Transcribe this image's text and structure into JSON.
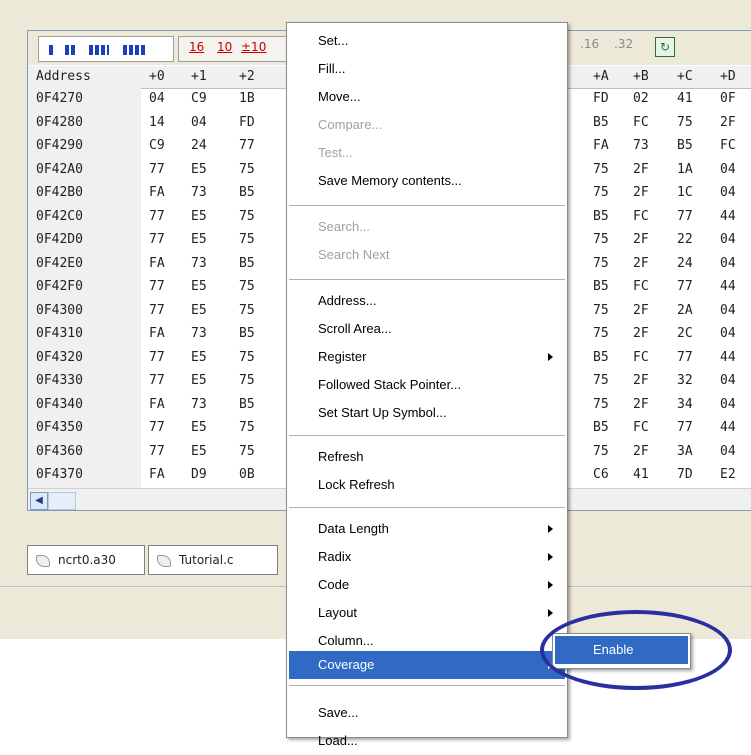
{
  "toolbar": {
    "radix_labels": [
      "16",
      "10",
      "±10"
    ],
    "radix_right_labels": [
      ".16",
      ".32"
    ],
    "refresh_glyph": "↻"
  },
  "table": {
    "headers": [
      "Address",
      "+0",
      "+1",
      "+2",
      "+A",
      "+B",
      "+C",
      "+D"
    ],
    "rows": [
      {
        "addr": "0F4270",
        "left": [
          "04",
          "C9",
          "1B"
        ],
        "right": [
          "FD",
          "02",
          "41",
          "0F"
        ]
      },
      {
        "addr": "0F4280",
        "left": [
          "14",
          "04",
          "FD"
        ],
        "right": [
          "B5",
          "FC",
          "75",
          "2F"
        ]
      },
      {
        "addr": "0F4290",
        "left": [
          "C9",
          "24",
          "77"
        ],
        "right": [
          "FA",
          "73",
          "B5",
          "FC"
        ]
      },
      {
        "addr": "0F42A0",
        "left": [
          "77",
          "E5",
          "75"
        ],
        "right": [
          "75",
          "2F",
          "1A",
          "04"
        ]
      },
      {
        "addr": "0F42B0",
        "left": [
          "FA",
          "73",
          "B5"
        ],
        "right": [
          "75",
          "2F",
          "1C",
          "04"
        ]
      },
      {
        "addr": "0F42C0",
        "left": [
          "77",
          "E5",
          "75"
        ],
        "right": [
          "B5",
          "FC",
          "77",
          "44"
        ]
      },
      {
        "addr": "0F42D0",
        "left": [
          "77",
          "E5",
          "75"
        ],
        "right": [
          "75",
          "2F",
          "22",
          "04"
        ]
      },
      {
        "addr": "0F42E0",
        "left": [
          "FA",
          "73",
          "B5"
        ],
        "right": [
          "75",
          "2F",
          "24",
          "04"
        ]
      },
      {
        "addr": "0F42F0",
        "left": [
          "77",
          "E5",
          "75"
        ],
        "right": [
          "B5",
          "FC",
          "77",
          "44"
        ]
      },
      {
        "addr": "0F4300",
        "left": [
          "77",
          "E5",
          "75"
        ],
        "right": [
          "75",
          "2F",
          "2A",
          "04"
        ]
      },
      {
        "addr": "0F4310",
        "left": [
          "FA",
          "73",
          "B5"
        ],
        "right": [
          "75",
          "2F",
          "2C",
          "04"
        ]
      },
      {
        "addr": "0F4320",
        "left": [
          "77",
          "E5",
          "75"
        ],
        "right": [
          "B5",
          "FC",
          "77",
          "44"
        ]
      },
      {
        "addr": "0F4330",
        "left": [
          "77",
          "E5",
          "75"
        ],
        "right": [
          "75",
          "2F",
          "32",
          "04"
        ]
      },
      {
        "addr": "0F4340",
        "left": [
          "FA",
          "73",
          "B5"
        ],
        "right": [
          "75",
          "2F",
          "34",
          "04"
        ]
      },
      {
        "addr": "0F4350",
        "left": [
          "77",
          "E5",
          "75"
        ],
        "right": [
          "B5",
          "FC",
          "77",
          "44"
        ]
      },
      {
        "addr": "0F4360",
        "left": [
          "77",
          "E5",
          "75"
        ],
        "right": [
          "75",
          "2F",
          "3A",
          "04"
        ]
      },
      {
        "addr": "0F4370",
        "left": [
          "FA",
          "D9",
          "0B"
        ],
        "right": [
          "C6",
          "41",
          "7D",
          "E2"
        ]
      }
    ]
  },
  "tabs": [
    {
      "label": "ncrt0.a30"
    },
    {
      "label": "Tutorial.c"
    }
  ],
  "context_menu": {
    "items": [
      {
        "label": "Set...",
        "disabled": false,
        "submenu": false
      },
      {
        "label": "Fill...",
        "disabled": false,
        "submenu": false
      },
      {
        "label": "Move...",
        "disabled": false,
        "submenu": false
      },
      {
        "label": "Compare...",
        "disabled": true,
        "submenu": false
      },
      {
        "label": "Test...",
        "disabled": true,
        "submenu": false
      },
      {
        "label": "Save Memory contents...",
        "disabled": false,
        "submenu": false
      },
      {
        "label": "Search...",
        "disabled": true,
        "submenu": false
      },
      {
        "label": "Search Next",
        "disabled": true,
        "submenu": false
      },
      {
        "label": "Address...",
        "disabled": false,
        "submenu": false
      },
      {
        "label": "Scroll Area...",
        "disabled": false,
        "submenu": false
      },
      {
        "label": "Register",
        "disabled": false,
        "submenu": true
      },
      {
        "label": "Followed Stack Pointer...",
        "disabled": false,
        "submenu": false
      },
      {
        "label": "Set Start Up Symbol...",
        "disabled": false,
        "submenu": false
      },
      {
        "label": "Refresh",
        "disabled": false,
        "submenu": false
      },
      {
        "label": "Lock Refresh",
        "disabled": false,
        "submenu": false
      },
      {
        "label": "Data Length",
        "disabled": false,
        "submenu": true
      },
      {
        "label": "Radix",
        "disabled": false,
        "submenu": true
      },
      {
        "label": "Code",
        "disabled": false,
        "submenu": true
      },
      {
        "label": "Layout",
        "disabled": false,
        "submenu": true
      },
      {
        "label": "Column...",
        "disabled": false,
        "submenu": false
      },
      {
        "label": "Coverage",
        "disabled": false,
        "submenu": true,
        "selected": true
      },
      {
        "label": "Save...",
        "disabled": false,
        "submenu": false
      },
      {
        "label": "Load...",
        "disabled": false,
        "submenu": false
      }
    ]
  },
  "coverage_submenu": {
    "items": [
      {
        "label": "Enable",
        "selected": true
      }
    ]
  },
  "colors": {
    "selection": "#316ac5",
    "highlight_ring": "#2a2fa0",
    "toolbar_icon": "#1a3fbf",
    "radix_text": "#cc0000"
  }
}
